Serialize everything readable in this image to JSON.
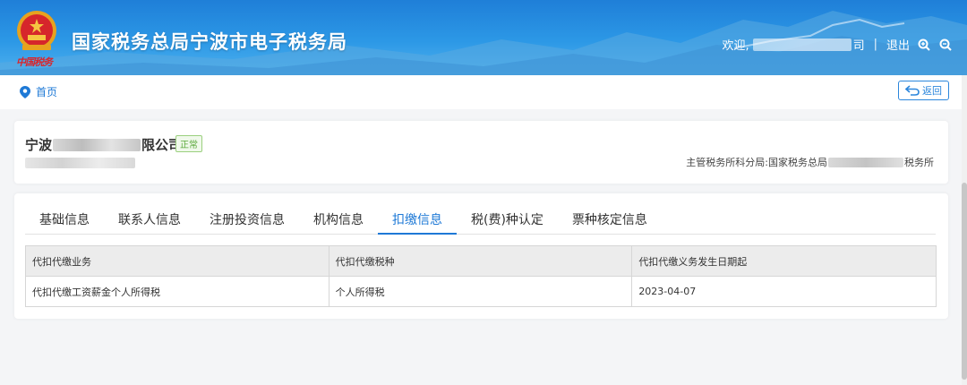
{
  "header": {
    "title": "国家税务总局宁波市电子税务局",
    "brand_tag": "中国税务",
    "welcome": "欢迎,",
    "user_suffix": "司",
    "separator": "|",
    "logout": "退出"
  },
  "breadcrumb": {
    "home": "首页"
  },
  "back_button": {
    "label": "返回"
  },
  "company": {
    "name_prefix": "宁波",
    "name_suffix": "限公司",
    "status": "正常",
    "bureau_label": "主管税务所科分局:",
    "bureau_prefix": "国家税务总局",
    "bureau_suffix": "税务所"
  },
  "tabs": [
    {
      "label": "基础信息",
      "active": false
    },
    {
      "label": "联系人信息",
      "active": false
    },
    {
      "label": "注册投资信息",
      "active": false
    },
    {
      "label": "机构信息",
      "active": false
    },
    {
      "label": "扣缴信息",
      "active": true
    },
    {
      "label": "税(费)种认定",
      "active": false
    },
    {
      "label": "票种核定信息",
      "active": false
    }
  ],
  "table": {
    "headers": [
      "代扣代缴业务",
      "代扣代缴税种",
      "代扣代缴义务发生日期起"
    ],
    "rows": [
      [
        "代扣代缴工资薪金个人所得税",
        "个人所得税",
        "2023-04-07"
      ]
    ]
  },
  "colors": {
    "accent": "#1e79d6",
    "status_green": "#5aa83a",
    "header_blue": "#1f7fd8"
  },
  "icons": {
    "emblem": "national-emblem-icon",
    "location": "location-pin-icon",
    "back": "return-arrow-icon",
    "zoom_in": "zoom-in-icon",
    "zoom_out": "zoom-out-icon"
  }
}
